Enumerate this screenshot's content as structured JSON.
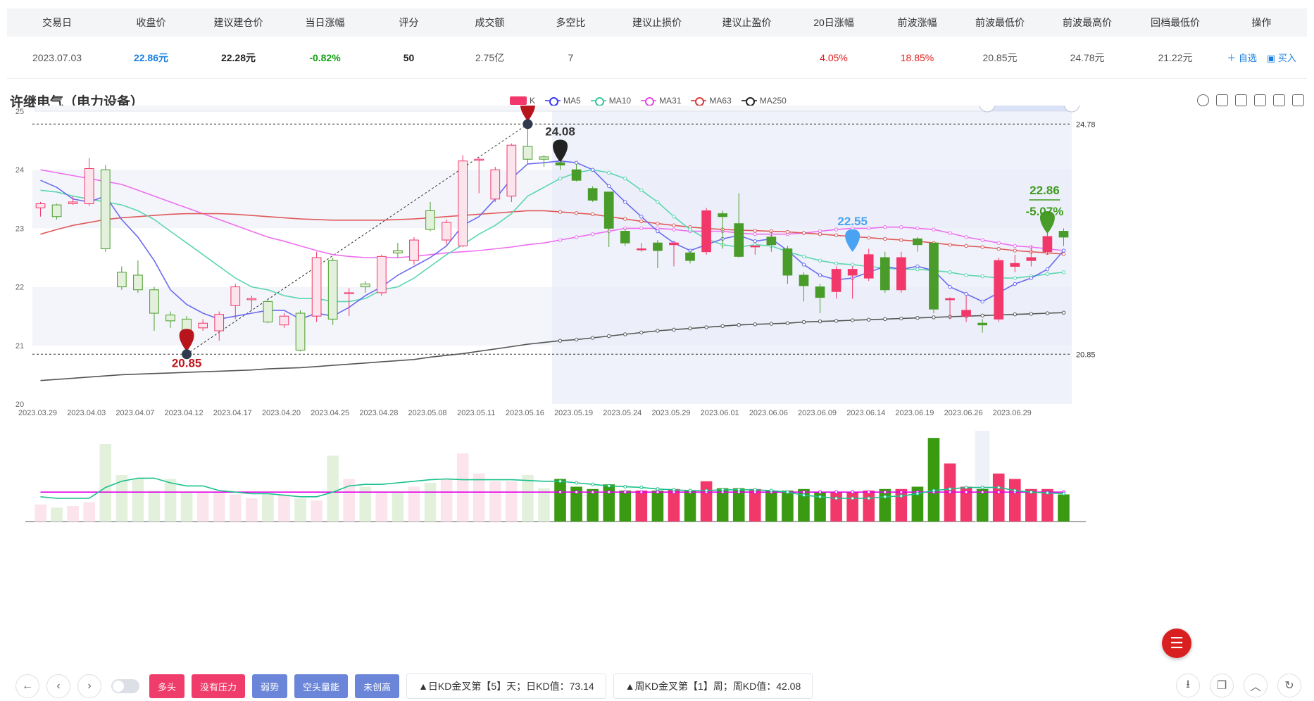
{
  "summary": {
    "headers": [
      "交易日",
      "收盘价",
      "建议建仓价",
      "当日涨幅",
      "评分",
      "成交额",
      "多空比",
      "建议止损价",
      "建议止盈价",
      "20日涨幅",
      "前波涨幅",
      "前波最低价",
      "前波最高价",
      "回档最低价",
      "操作"
    ],
    "row": {
      "date": "2023.07.03",
      "close": "22.86元",
      "build_price": "22.28元",
      "change": "-0.82%",
      "score": "50",
      "turnover": "2.75亿",
      "ls_ratio": "7",
      "stop_loss": "",
      "take_profit": "",
      "change20": "4.05%",
      "wave_change": "18.85%",
      "wave_low": "20.85元",
      "wave_high": "24.78元",
      "pullback_low": "21.22元",
      "op_watch": "＋ 自选",
      "op_buy": "▣ 买入"
    }
  },
  "stock_title": "许继电气（电力设备）",
  "legend": {
    "k": "K",
    "ma5": "MA5",
    "ma10": "MA10",
    "ma31": "MA31",
    "ma63": "MA63",
    "ma250": "MA250"
  },
  "colors": {
    "up": "#f2386a",
    "down": "#4a9c2a",
    "ma5": "#6b6bf0",
    "ma10": "#5bd6b0",
    "ma31": "#ee6ef0",
    "ma63": "#e05a5a",
    "ma250": "#555555"
  },
  "chart_data": {
    "type": "candlestick",
    "title": "许继电气（电力设备）",
    "ylim": [
      20,
      25
    ],
    "yticks": [
      20,
      21,
      22,
      23,
      24,
      25
    ],
    "xtick_labels": [
      "2023.03.29",
      "2023.04.03",
      "2023.04.07",
      "2023.04.12",
      "2023.04.17",
      "2023.04.20",
      "2023.04.25",
      "2023.04.28",
      "2023.05.08",
      "2023.05.11",
      "2023.05.16",
      "2023.05.19",
      "2023.05.24",
      "2023.05.29",
      "2023.06.01",
      "2023.06.06",
      "2023.06.09",
      "2023.06.14",
      "2023.06.19",
      "2023.06.26",
      "2023.06.29"
    ],
    "ref_lines": [
      24.78,
      20.85
    ],
    "ref_labels": [
      "24.78",
      "20.85"
    ],
    "annotations": [
      {
        "label": "24.78",
        "index": 30,
        "value": 24.78,
        "kind": "high"
      },
      {
        "label": "20.85",
        "index": 9,
        "value": 20.85,
        "kind": "low"
      },
      {
        "label": "24.08",
        "index": 32,
        "value": 24.08,
        "kind": "mark"
      },
      {
        "label": "22.55",
        "index": 50,
        "value": 22.55,
        "kind": "mark"
      },
      {
        "label": "22.86",
        "index": 62,
        "value": 22.86,
        "kind": "last"
      },
      {
        "label": "-5.07%",
        "index": 62,
        "value": 22.86,
        "kind": "last-pct"
      }
    ],
    "candles": [
      [
        23.35,
        23.42,
        23.45,
        23.2
      ],
      [
        23.4,
        23.2,
        23.42,
        23.15
      ],
      [
        23.42,
        23.45,
        23.55,
        23.4
      ],
      [
        23.42,
        24.02,
        24.2,
        23.38
      ],
      [
        24.0,
        22.65,
        24.08,
        22.6
      ],
      [
        22.25,
        22.0,
        22.35,
        21.95
      ],
      [
        22.2,
        21.95,
        22.45,
        21.9
      ],
      [
        21.95,
        21.55,
        22.0,
        21.25
      ],
      [
        21.52,
        21.42,
        21.58,
        21.3
      ],
      [
        21.45,
        21.12,
        21.5,
        21.0
      ],
      [
        21.3,
        21.38,
        21.45,
        21.25
      ],
      [
        21.25,
        21.53,
        21.58,
        21.08
      ],
      [
        21.68,
        22.0,
        22.05,
        21.45
      ],
      [
        21.78,
        21.8,
        21.85,
        21.6
      ],
      [
        21.75,
        21.4,
        21.8,
        21.38
      ],
      [
        21.35,
        21.5,
        21.55,
        21.3
      ],
      [
        21.55,
        20.92,
        21.6,
        20.9
      ],
      [
        21.5,
        22.5,
        22.6,
        21.4
      ],
      [
        22.45,
        21.45,
        22.5,
        21.35
      ],
      [
        21.9,
        21.9,
        21.98,
        21.5
      ],
      [
        22.05,
        22.0,
        22.1,
        21.9
      ],
      [
        21.9,
        22.52,
        22.55,
        21.85
      ],
      [
        22.62,
        22.58,
        22.75,
        22.5
      ],
      [
        22.45,
        22.8,
        22.85,
        22.38
      ],
      [
        23.3,
        22.98,
        23.45,
        22.95
      ],
      [
        22.8,
        23.1,
        23.15,
        22.72
      ],
      [
        22.7,
        24.15,
        24.25,
        22.68
      ],
      [
        24.18,
        24.18,
        24.2,
        23.6
      ],
      [
        23.5,
        24.0,
        24.05,
        23.45
      ],
      [
        23.55,
        24.42,
        24.45,
        23.45
      ],
      [
        24.4,
        24.18,
        24.78,
        24.1
      ],
      [
        24.22,
        24.18,
        24.25,
        24.05
      ],
      [
        24.12,
        24.08,
        24.2,
        24.0
      ],
      [
        24.0,
        23.82,
        24.1,
        23.8
      ],
      [
        23.68,
        23.48,
        23.72,
        23.45
      ],
      [
        23.62,
        23.0,
        23.62,
        22.68
      ],
      [
        22.95,
        22.75,
        23.0,
        22.7
      ],
      [
        22.65,
        22.65,
        22.75,
        22.6
      ],
      [
        22.75,
        22.62,
        22.8,
        22.32
      ],
      [
        22.72,
        22.75,
        22.78,
        22.35
      ],
      [
        22.58,
        22.45,
        22.62,
        22.4
      ],
      [
        22.6,
        23.3,
        23.35,
        22.55
      ],
      [
        23.25,
        23.2,
        23.3,
        22.65
      ],
      [
        23.08,
        22.52,
        23.6,
        22.5
      ],
      [
        22.7,
        22.7,
        22.72,
        22.55
      ],
      [
        22.85,
        22.72,
        22.95,
        22.6
      ],
      [
        22.65,
        22.2,
        22.7,
        22.05
      ],
      [
        22.2,
        22.02,
        22.25,
        21.75
      ],
      [
        22.0,
        21.82,
        22.05,
        21.55
      ],
      [
        21.92,
        22.3,
        22.35,
        21.8
      ],
      [
        22.2,
        22.3,
        22.35,
        21.8
      ],
      [
        22.15,
        22.55,
        22.65,
        22.1
      ],
      [
        22.5,
        21.95,
        22.6,
        21.9
      ],
      [
        21.95,
        22.5,
        22.6,
        21.9
      ],
      [
        22.82,
        22.72,
        22.85,
        22.6
      ],
      [
        22.75,
        21.62,
        22.75,
        21.55
      ],
      [
        21.78,
        21.8,
        21.82,
        21.45
      ],
      [
        21.5,
        21.6,
        21.85,
        21.4
      ],
      [
        21.38,
        21.35,
        21.45,
        21.22
      ],
      [
        21.45,
        22.45,
        22.5,
        21.4
      ],
      [
        22.35,
        22.4,
        22.55,
        22.25
      ],
      [
        22.45,
        22.5,
        22.7,
        22.35
      ],
      [
        22.6,
        22.86,
        23.05,
        22.55
      ],
      [
        22.95,
        22.85,
        23.0,
        22.7
      ]
    ],
    "ma5": [
      23.82,
      23.7,
      23.5,
      23.45,
      23.55,
      23.15,
      22.85,
      22.45,
      21.95,
      21.7,
      21.55,
      21.45,
      21.5,
      21.55,
      21.6,
      21.6,
      21.45,
      21.55,
      21.5,
      21.65,
      21.85,
      22.0,
      22.2,
      22.35,
      22.5,
      22.7,
      23.05,
      23.2,
      23.5,
      23.85,
      24.1,
      24.12,
      24.15,
      24.12,
      24.0,
      23.72,
      23.45,
      23.2,
      22.95,
      22.75,
      22.62,
      22.72,
      22.82,
      22.88,
      22.78,
      22.82,
      22.62,
      22.38,
      22.2,
      22.12,
      22.15,
      22.25,
      22.35,
      22.3,
      22.35,
      22.28,
      22.0,
      21.88,
      21.75,
      21.9,
      22.05,
      22.15,
      22.3,
      22.62
    ],
    "ma10": [
      23.65,
      23.62,
      23.55,
      23.5,
      23.45,
      23.4,
      23.3,
      23.15,
      22.95,
      22.75,
      22.55,
      22.35,
      22.15,
      22.0,
      21.95,
      21.85,
      21.8,
      21.8,
      21.75,
      21.75,
      21.8,
      21.95,
      22.0,
      22.15,
      22.35,
      22.55,
      22.72,
      22.9,
      23.05,
      23.25,
      23.55,
      23.7,
      23.85,
      23.95,
      24.0,
      23.95,
      23.85,
      23.65,
      23.45,
      23.2,
      22.98,
      22.82,
      22.72,
      22.68,
      22.72,
      22.7,
      22.6,
      22.52,
      22.45,
      22.4,
      22.38,
      22.35,
      22.32,
      22.3,
      22.3,
      22.28,
      22.25,
      22.2,
      22.18,
      22.15,
      22.15,
      22.18,
      22.22,
      22.25
    ],
    "ma31": [
      24.0,
      23.95,
      23.9,
      23.85,
      23.8,
      23.75,
      23.65,
      23.55,
      23.45,
      23.35,
      23.25,
      23.15,
      23.05,
      22.95,
      22.85,
      22.78,
      22.7,
      22.62,
      22.55,
      22.52,
      22.5,
      22.5,
      22.5,
      22.52,
      22.55,
      22.58,
      22.6,
      22.62,
      22.65,
      22.68,
      22.72,
      22.75,
      22.8,
      22.85,
      22.9,
      22.95,
      23.0,
      23.0,
      23.0,
      22.98,
      22.95,
      22.95,
      22.95,
      22.92,
      22.9,
      22.9,
      22.9,
      22.92,
      22.95,
      22.98,
      23.0,
      23.0,
      23.02,
      23.02,
      23.0,
      22.98,
      22.92,
      22.85,
      22.8,
      22.75,
      22.7,
      22.68,
      22.65,
      22.62
    ],
    "ma63": [
      22.9,
      22.98,
      23.05,
      23.1,
      23.15,
      23.18,
      23.2,
      23.22,
      23.24,
      23.25,
      23.25,
      23.25,
      23.24,
      23.22,
      23.2,
      23.18,
      23.16,
      23.15,
      23.14,
      23.14,
      23.14,
      23.14,
      23.15,
      23.16,
      23.18,
      23.2,
      23.22,
      23.24,
      23.26,
      23.28,
      23.3,
      23.3,
      23.28,
      23.26,
      23.24,
      23.2,
      23.16,
      23.12,
      23.08,
      23.05,
      23.02,
      23.0,
      22.98,
      22.97,
      22.96,
      22.95,
      22.94,
      22.92,
      22.9,
      22.88,
      22.86,
      22.84,
      22.82,
      22.8,
      22.78,
      22.75,
      22.72,
      22.7,
      22.68,
      22.65,
      22.62,
      22.6,
      22.58,
      22.56
    ],
    "ma250": [
      20.4,
      20.42,
      20.44,
      20.46,
      20.48,
      20.5,
      20.51,
      20.52,
      20.53,
      20.54,
      20.55,
      20.56,
      20.57,
      20.58,
      20.6,
      20.61,
      20.62,
      20.64,
      20.66,
      20.68,
      20.7,
      20.72,
      20.74,
      20.76,
      20.8,
      20.83,
      20.86,
      20.9,
      20.94,
      20.98,
      21.02,
      21.05,
      21.08,
      21.1,
      21.13,
      21.16,
      21.19,
      21.22,
      21.25,
      21.27,
      21.29,
      21.31,
      21.33,
      21.35,
      21.36,
      21.37,
      21.38,
      21.4,
      21.41,
      21.42,
      21.43,
      21.44,
      21.45,
      21.46,
      21.47,
      21.48,
      21.49,
      21.5,
      21.51,
      21.52,
      21.53,
      21.54,
      21.55,
      21.56
    ],
    "volume": [
      22,
      18,
      20,
      25,
      100,
      60,
      55,
      40,
      55,
      38,
      38,
      38,
      35,
      30,
      35,
      35,
      30,
      27,
      85,
      55,
      45,
      38,
      38,
      45,
      50,
      55,
      88,
      62,
      52,
      52,
      60,
      43,
      55,
      45,
      42,
      48,
      40,
      40,
      40,
      42,
      40,
      52,
      43,
      43,
      42,
      40,
      40,
      42,
      38,
      38,
      38,
      40,
      42,
      42,
      45,
      108,
      75,
      45,
      42,
      62,
      55,
      42,
      42,
      35
    ],
    "vol_ma_a": [
      32,
      30,
      30,
      30,
      44,
      52,
      56,
      56,
      50,
      46,
      46,
      40,
      38,
      36,
      36,
      34,
      32,
      32,
      38,
      46,
      48,
      48,
      50,
      52,
      54,
      55,
      54,
      54,
      54,
      54,
      53,
      52,
      52,
      50,
      48,
      46,
      45,
      44,
      42,
      41,
      40,
      40,
      41,
      41,
      41,
      40,
      38,
      34,
      32,
      30,
      30,
      30,
      32,
      33,
      36,
      40,
      42,
      44,
      44,
      44,
      40,
      38,
      37,
      36
    ],
    "vol_ma_b": [
      38,
      38,
      38,
      38,
      38,
      38,
      38,
      38,
      38,
      38,
      38,
      38,
      38,
      38,
      38,
      38,
      38,
      38,
      38,
      38,
      38,
      38,
      38,
      38,
      38,
      38,
      38,
      38,
      38,
      38,
      38,
      38,
      38,
      38,
      38,
      38,
      38,
      38,
      38,
      38,
      38,
      38,
      38,
      38,
      38,
      38,
      38,
      38,
      38,
      38,
      38,
      38,
      38,
      38,
      38,
      38,
      38,
      38,
      38,
      38,
      38,
      38,
      38,
      38
    ]
  },
  "bottom": {
    "tags": [
      "多头",
      "没有压力",
      "弱势",
      "空头量能",
      "未创高"
    ],
    "kd_day": "▲日KD金叉第【5】天；日KD值：73.14",
    "kd_week": "▲周KD金叉第【1】周；周KD值：42.08"
  }
}
